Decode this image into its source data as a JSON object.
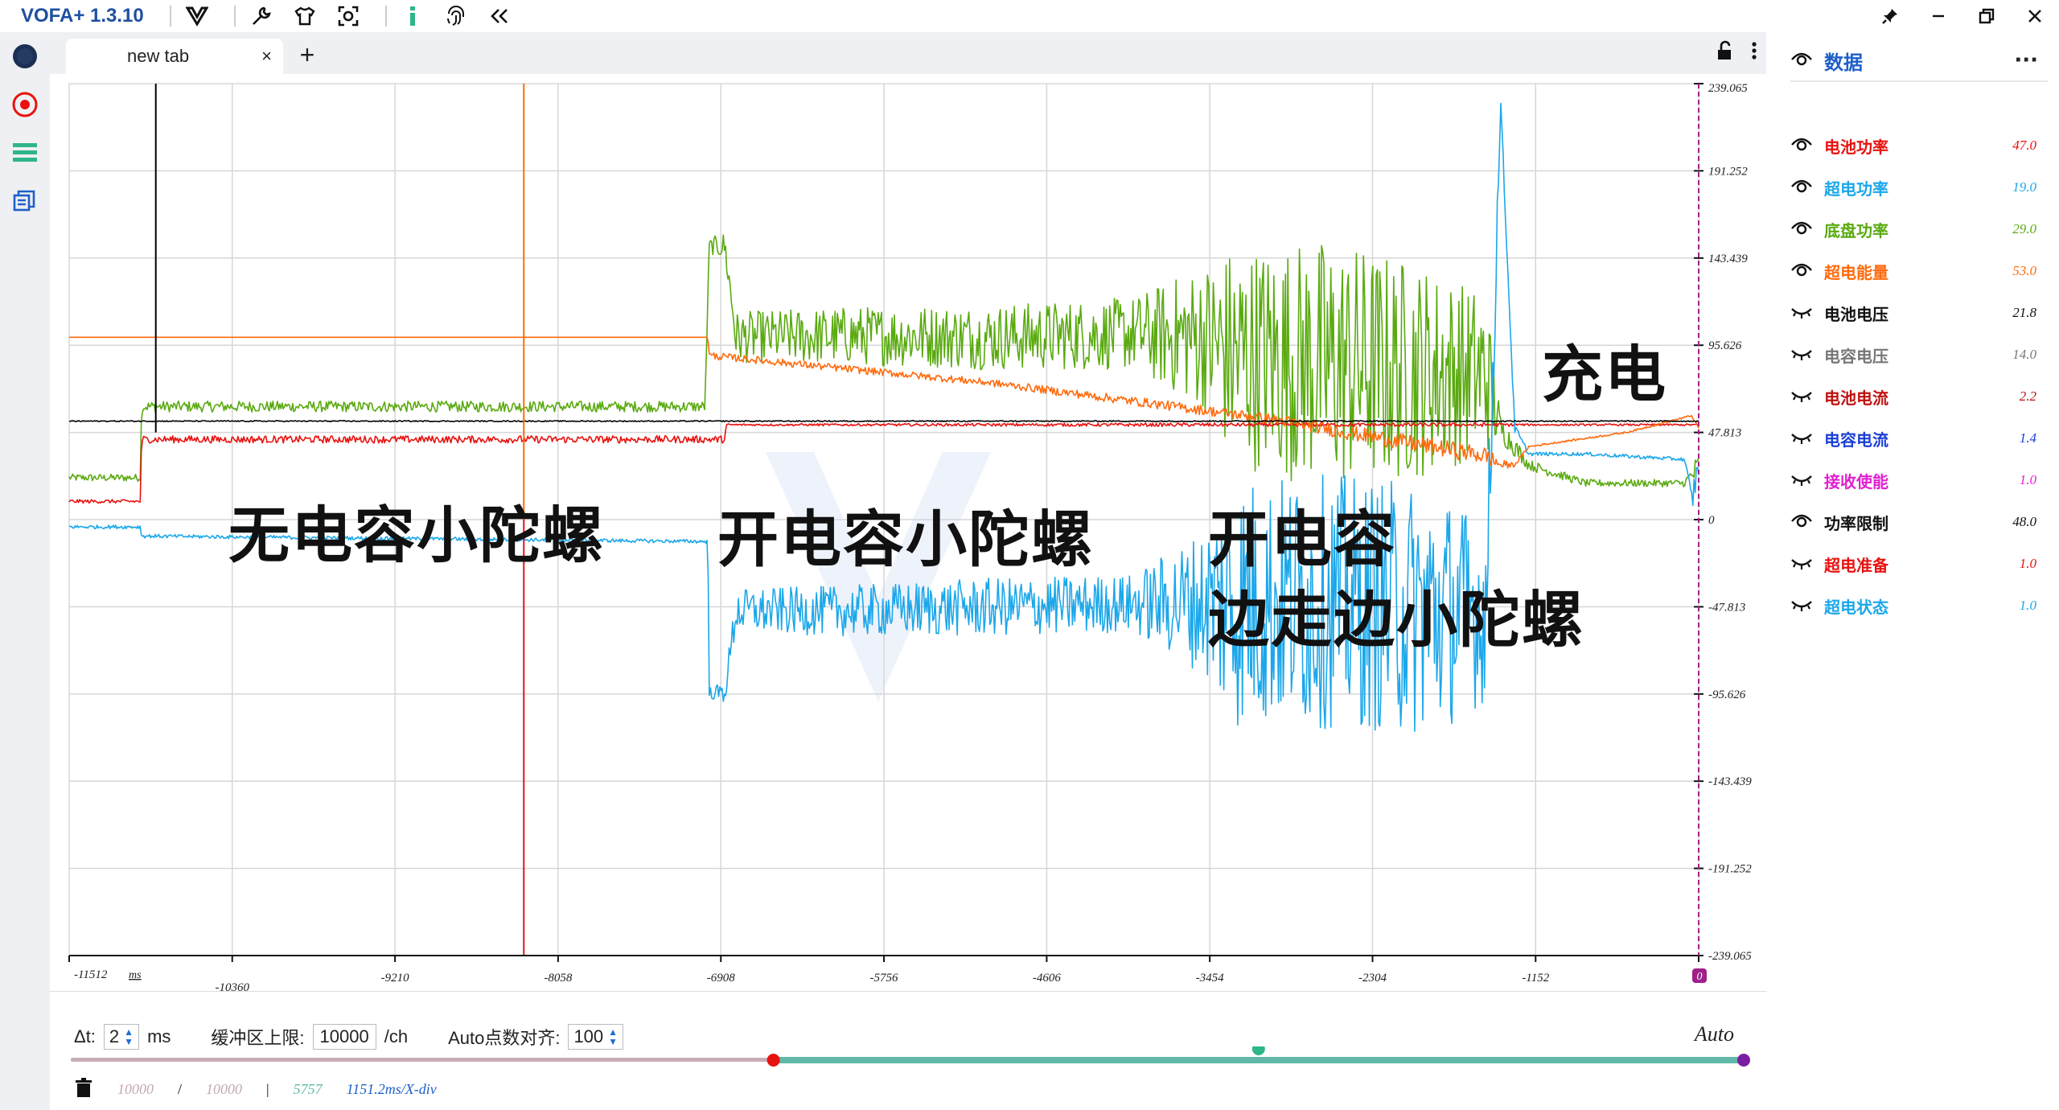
{
  "app": {
    "title": "VOFA+ 1.3.10",
    "toolbar_icons": [
      "vofa-logo-icon",
      "wrench-icon",
      "shirt-icon",
      "screenshot-icon",
      "info-icon",
      "fingerprint-icon",
      "collapse-left-icon"
    ],
    "window_controls": [
      "pin-icon",
      "minimize-icon",
      "restore-icon",
      "close-icon"
    ]
  },
  "left_rail": {
    "icons": [
      "connection-status-icon",
      "record-icon",
      "menu-list-icon",
      "windows-icon"
    ]
  },
  "tabs": [
    {
      "label": "new tab",
      "close": "×"
    }
  ],
  "tab_add": "+",
  "annotations": {
    "a1": "无电容小陀螺",
    "a2": "开电容小陀螺",
    "a3_line1": "开电容",
    "a3_line2": "边走边小陀螺",
    "a4": "充电"
  },
  "chart_data": {
    "type": "line",
    "title": "",
    "xlabel": "ms",
    "ylabel": "",
    "x_ticks": [
      -11512,
      -10360,
      -9210,
      -8058,
      -6908,
      -5756,
      -4606,
      -3454,
      -2304,
      -1152,
      0
    ],
    "x_tick_labels": [
      "-11512",
      "-10360",
      "-9210",
      "-8058",
      "-6908",
      "-5756",
      "-4606",
      "-3454",
      "-2304",
      "-1152",
      "0"
    ],
    "y_ticks": [
      239.065,
      191.252,
      143.439,
      95.626,
      47.813,
      0,
      -47.813,
      -95.626,
      -143.439,
      -191.252,
      -239.065
    ],
    "y_tick_labels": [
      "239.065",
      "191.252",
      "143.439",
      "95.626",
      "47.813",
      "0",
      "-47.813",
      "-95.626",
      "-143.439",
      "-191.252",
      "-239.065"
    ],
    "xlim": [
      -11512,
      0
    ],
    "ylim": [
      -239.065,
      239.065
    ],
    "grid": true,
    "series": [
      {
        "name": "底盘功率",
        "color": "#5aaa10",
        "x": [
          -11512,
          -11010,
          -11000,
          -7020,
          -6990,
          -6880,
          -6800,
          -6000,
          -5000,
          -4000,
          -3500,
          -3300,
          -2600,
          -2000,
          -1500,
          -1400,
          -1200,
          -800,
          -100,
          0
        ],
        "y": [
          23,
          23,
          62,
          62,
          150,
          150,
          100,
          101,
          100,
          102,
          100,
          90,
          85,
          82,
          80,
          50,
          30,
          20,
          20,
          28
        ],
        "noise": [
          2,
          2,
          3,
          3,
          4,
          8,
          14,
          16,
          18,
          20,
          40,
          60,
          70,
          60,
          45,
          8,
          3,
          2,
          2,
          10
        ]
      },
      {
        "name": "电池功率",
        "color": "#e8120f",
        "x": [
          -11512,
          -11010,
          -11000,
          -6880,
          -6870,
          -3400,
          -2000,
          -1400,
          -1200,
          0
        ],
        "y": [
          10,
          10,
          44,
          44,
          52,
          52,
          52,
          52,
          52,
          52
        ],
        "noise": [
          1,
          1,
          2,
          2,
          0.5,
          1,
          1,
          1,
          0.5,
          0.5
        ]
      },
      {
        "name": "超电功率",
        "color": "#1ba7ea",
        "x": [
          -11512,
          -11010,
          -11000,
          -7000,
          -6990,
          -6880,
          -6800,
          -6000,
          -5000,
          -4000,
          -3500,
          -3300,
          -2500,
          -1900,
          -1500,
          -1400,
          -1300,
          -1200,
          -800,
          -100,
          -50,
          0
        ],
        "y": [
          -4,
          -4,
          -9,
          -12,
          -95,
          -95,
          -50,
          -50,
          -48,
          -46,
          -45,
          -45,
          -45,
          -50,
          -50,
          230,
          50,
          36,
          36,
          33,
          10,
          30
        ],
        "noise": [
          1,
          1,
          1,
          1,
          3,
          6,
          12,
          14,
          16,
          16,
          40,
          70,
          70,
          70,
          50,
          5,
          3,
          1,
          1,
          1,
          8,
          8
        ]
      },
      {
        "name": "超电能量",
        "color": "#ff6a0c",
        "x": [
          -11512,
          -7000,
          -6990,
          -5000,
          -3000,
          -2500,
          -1500,
          -1400,
          -1300,
          -1200,
          -500,
          -50,
          0
        ],
        "y": [
          100,
          100,
          90,
          75,
          55,
          48,
          35,
          30,
          30,
          40,
          48,
          57,
          50
        ],
        "noise": [
          0,
          0,
          2,
          2,
          3,
          4,
          5,
          3,
          1,
          0.5,
          0.5,
          0.5,
          0.5
        ]
      },
      {
        "name": "电池电压",
        "color": "#000000",
        "x": [
          -11512,
          0
        ],
        "y": [
          54,
          54
        ],
        "noise": [
          0.3,
          0.3
        ]
      }
    ],
    "cursors": [
      {
        "x": -10900,
        "color": "#000000"
      },
      {
        "x": -8300,
        "color_top": "#ff6a0c",
        "color_bottom": "#e8120f"
      }
    ],
    "trigger_line_x": 0,
    "trigger_color": "#a0208a"
  },
  "controls": {
    "dt_label": "Δt:",
    "dt_value": "2",
    "dt_unit": "ms",
    "buffer_label": "缓冲区上限:",
    "buffer_value": "10000",
    "buffer_unit": "/ch",
    "auto_align_label": "Auto点数对齐:",
    "auto_align_value": "100",
    "auto_label": "Auto",
    "slider": {
      "left_fraction": 0.42,
      "mid_fraction": 0.71,
      "right_fraction": 1.0
    },
    "stats": {
      "count_a": "10000",
      "sep1": "/",
      "count_b": "10000",
      "sep2": "|",
      "points": "5757",
      "scale": "1151.2ms/X-div"
    }
  },
  "channels_panel": {
    "title": "数据",
    "more": "···",
    "channels": [
      {
        "name": "电池功率",
        "value": "47.0",
        "color": "#e8120f",
        "visible": true
      },
      {
        "name": "超电功率",
        "value": "19.0",
        "color": "#1ba7ea",
        "visible": true
      },
      {
        "name": "底盘功率",
        "value": "29.0",
        "color": "#5aaa10",
        "visible": true
      },
      {
        "name": "超电能量",
        "value": "53.0",
        "color": "#ff6a0c",
        "visible": true
      },
      {
        "name": "电池电压",
        "value": "21.8",
        "color": "#111111",
        "visible": false
      },
      {
        "name": "电容电压",
        "value": "14.0",
        "color": "#777777",
        "visible": false
      },
      {
        "name": "电池电流",
        "value": "2.2",
        "color": "#c01010",
        "visible": false
      },
      {
        "name": "电容电流",
        "value": "1.4",
        "color": "#1a3fd6",
        "visible": false
      },
      {
        "name": "接收使能",
        "value": "1.0",
        "color": "#e020d0",
        "visible": false
      },
      {
        "name": "功率限制",
        "value": "48.0",
        "color": "#111111",
        "visible": true
      },
      {
        "name": "超电准备",
        "value": "1.0",
        "color": "#e8120f",
        "visible": false
      },
      {
        "name": "超电状态",
        "value": "1.0",
        "color": "#1ba7ea",
        "visible": false
      }
    ]
  }
}
